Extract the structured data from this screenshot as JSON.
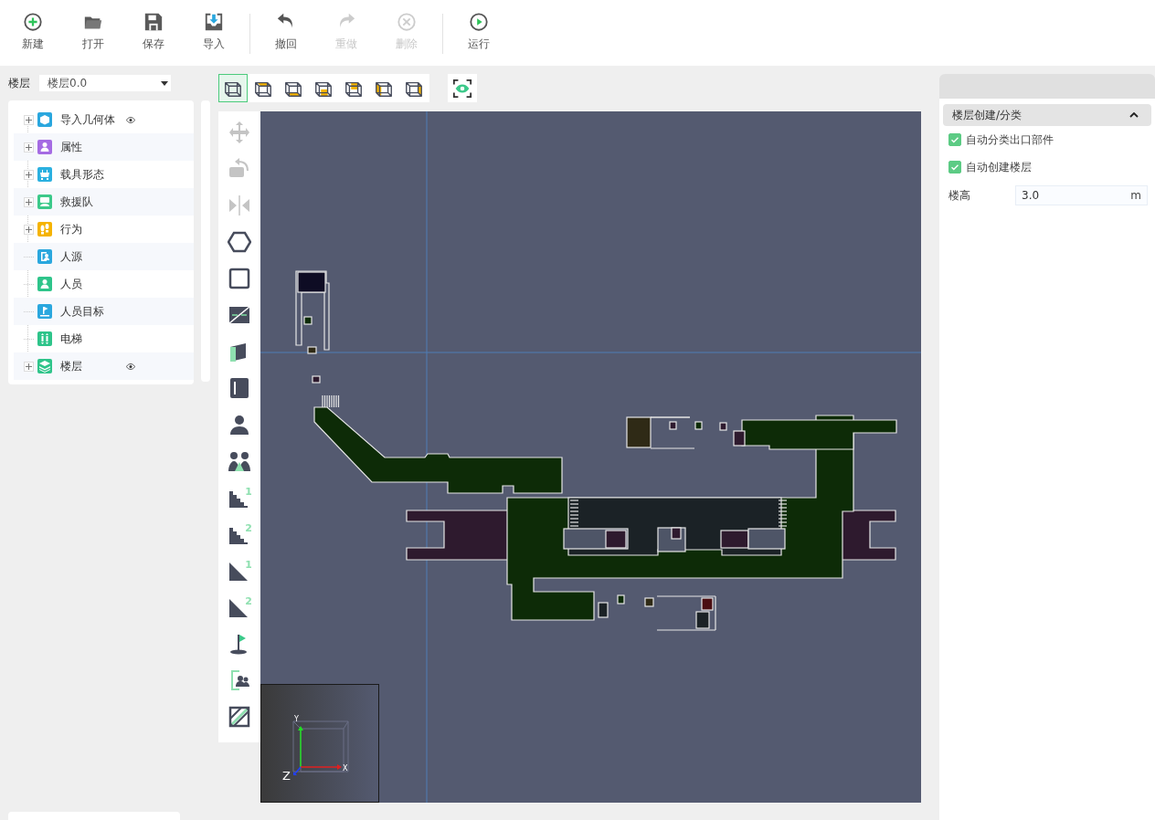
{
  "toolbar": {
    "groups": [
      [
        {
          "label": "新建",
          "kind": "new",
          "disabled": false
        },
        {
          "label": "打开",
          "kind": "open",
          "disabled": false
        },
        {
          "label": "保存",
          "kind": "save",
          "disabled": false
        },
        {
          "label": "导入",
          "kind": "import",
          "disabled": false
        }
      ],
      [
        {
          "label": "撤回",
          "kind": "undo",
          "disabled": false
        },
        {
          "label": "重做",
          "kind": "redo",
          "disabled": true
        },
        {
          "label": "删除",
          "kind": "delete",
          "disabled": true
        }
      ],
      [
        {
          "label": "运行",
          "kind": "run",
          "disabled": false
        }
      ]
    ]
  },
  "left_panel": {
    "floor_label": "楼层",
    "floor_select": "楼层0.0",
    "tree": [
      {
        "label": "导入几何体",
        "kind": "cube",
        "color": "#2aa7de",
        "expandable": true,
        "visible": true
      },
      {
        "label": "属性",
        "kind": "person",
        "color": "#a56be3",
        "expandable": true,
        "visible": false
      },
      {
        "label": "载具形态",
        "kind": "cart",
        "color": "#2ab0e0",
        "expandable": true,
        "visible": false
      },
      {
        "label": "救援队",
        "kind": "team",
        "color": "#3cc98a",
        "expandable": true,
        "visible": false
      },
      {
        "label": "行为",
        "kind": "steps",
        "color": "#f5b301",
        "expandable": true,
        "visible": false
      },
      {
        "label": "人源",
        "kind": "source",
        "color": "#2aa7de",
        "expandable": false,
        "visible": false
      },
      {
        "label": "人员",
        "kind": "person",
        "color": "#2ec48a",
        "expandable": false,
        "visible": false
      },
      {
        "label": "人员目标",
        "kind": "flag",
        "color": "#2aa7de",
        "expandable": false,
        "visible": false
      },
      {
        "label": "电梯",
        "kind": "elevator",
        "color": "#2ec48a",
        "expandable": false,
        "visible": false
      },
      {
        "label": "楼层",
        "kind": "layers",
        "color": "#2ec48a",
        "expandable": true,
        "visible": true
      }
    ]
  },
  "view_buttons": [
    {
      "kind": "all",
      "selected": true
    },
    {
      "kind": "top",
      "selected": false
    },
    {
      "kind": "bottom",
      "selected": false
    },
    {
      "kind": "front",
      "selected": false
    },
    {
      "kind": "back",
      "selected": false
    },
    {
      "kind": "left",
      "selected": false
    },
    {
      "kind": "right",
      "selected": false
    }
  ],
  "tools": [
    {
      "kind": "move",
      "disabled": true
    },
    {
      "kind": "rotate",
      "disabled": true
    },
    {
      "kind": "mirror",
      "disabled": true
    },
    {
      "kind": "polygon",
      "disabled": false
    },
    {
      "kind": "rectangle",
      "disabled": false
    },
    {
      "kind": "split",
      "disabled": false
    },
    {
      "kind": "wall",
      "disabled": false
    },
    {
      "kind": "exit",
      "disabled": false
    },
    {
      "kind": "person",
      "disabled": false
    },
    {
      "kind": "group",
      "disabled": false
    },
    {
      "kind": "stairs",
      "badge": "1",
      "disabled": false
    },
    {
      "kind": "stairs",
      "badge": "2",
      "disabled": false
    },
    {
      "kind": "ramp",
      "badge": "1",
      "disabled": false
    },
    {
      "kind": "ramp",
      "badge": "2",
      "disabled": false
    },
    {
      "kind": "target",
      "disabled": false
    },
    {
      "kind": "source",
      "disabled": false
    },
    {
      "kind": "zone",
      "disabled": false
    }
  ],
  "gizmo": {
    "y_label": "Y",
    "x_label": "X",
    "z_label": "Z"
  },
  "properties": {
    "section": {
      "title": "楼层创建/分类",
      "expanded": true
    },
    "options": [
      {
        "label": "自动分类出口部件",
        "checked": true
      },
      {
        "label": "自动创建楼层",
        "checked": true
      }
    ],
    "fields": [
      {
        "label": "楼高",
        "value": "3.0",
        "unit": "m"
      }
    ]
  }
}
